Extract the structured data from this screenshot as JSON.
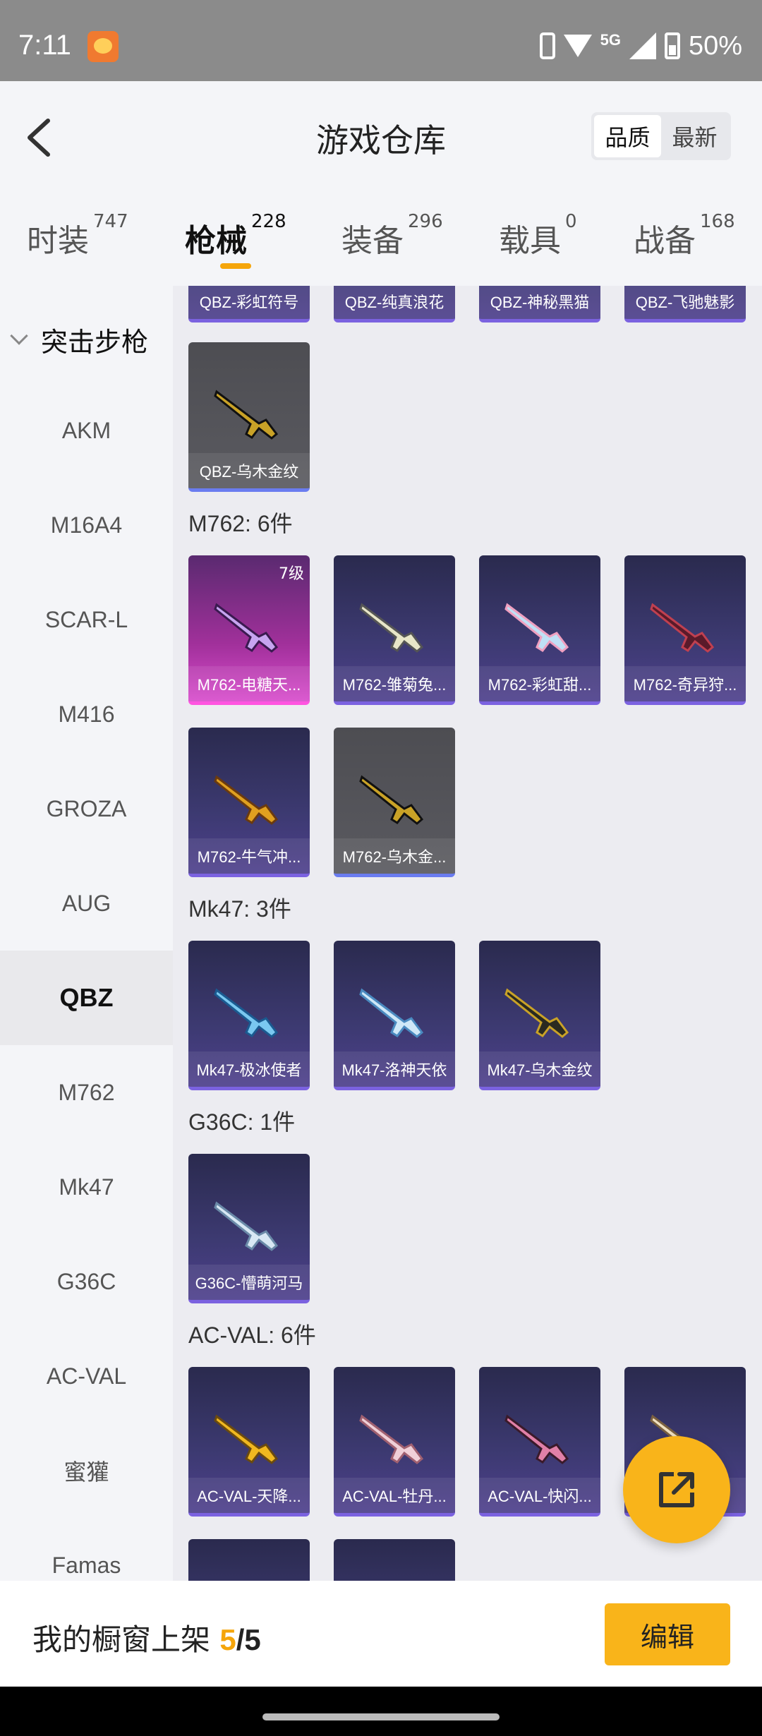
{
  "status_bar": {
    "time": "7:11",
    "network": "5G",
    "battery": "50%"
  },
  "header": {
    "title": "游戏仓库",
    "sort": [
      "品质",
      "最新"
    ]
  },
  "tabs": [
    {
      "label": "时装",
      "count": "747"
    },
    {
      "label": "枪械",
      "count": "228"
    },
    {
      "label": "装备",
      "count": "296"
    },
    {
      "label": "载具",
      "count": "0"
    },
    {
      "label": "战备",
      "count": "168"
    }
  ],
  "sidebar": {
    "group": "突击步枪",
    "items": [
      "AKM",
      "M16A4",
      "SCAR-L",
      "M416",
      "GROZA",
      "AUG",
      "QBZ",
      "M762",
      "Mk47",
      "G36C",
      "AC-VAL",
      "蜜獾",
      "Famas"
    ],
    "active": "QBZ"
  },
  "content": {
    "top_row": [
      "QBZ-彩虹符号",
      "QBZ-纯真浪花",
      "QBZ-神秘黑猫",
      "QBZ-飞驰魅影"
    ],
    "qbz_extra": "QBZ-乌木金纹",
    "sections": [
      {
        "title": "M762: 6件",
        "items": [
          "M762-电糖天...",
          "M762-雏菊兔...",
          "M762-彩虹甜...",
          "M762-奇异狩...",
          "M762-牛气冲...",
          "M762-乌木金..."
        ],
        "level_badge": "7级"
      },
      {
        "title": "Mk47: 3件",
        "items": [
          "Mk47-极冰使者",
          "Mk47-洛神天依",
          "Mk47-乌木金纹"
        ]
      },
      {
        "title": "G36C: 1件",
        "items": [
          "G36C-懵萌河马"
        ]
      },
      {
        "title": "AC-VAL: 6件",
        "items": [
          "AC-VAL-天降...",
          "AC-VAL-牡丹...",
          "AC-VAL-快闪...",
          ""
        ]
      }
    ]
  },
  "bottom": {
    "label": "我的橱窗上架 ",
    "current": "5",
    "total": "/5",
    "edit": "编辑"
  },
  "colors": {
    "accent": "#f9b41a",
    "card_purple": "#3d3a72",
    "card_pink": "#d84ccc",
    "card_grey": "#5a5a60"
  }
}
